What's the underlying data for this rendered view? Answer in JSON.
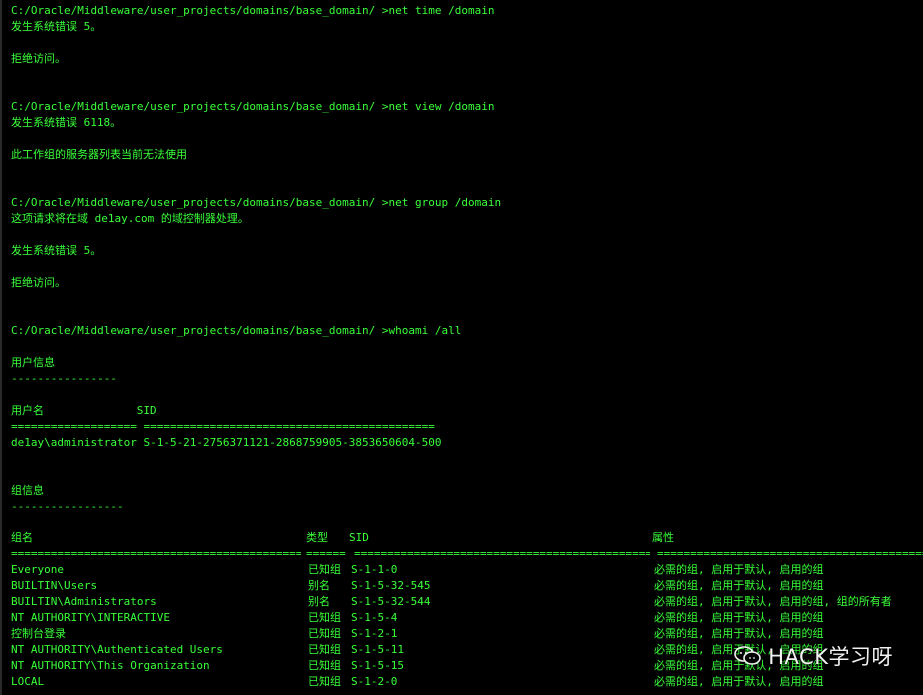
{
  "terminal": {
    "colors": {
      "background": "#000000",
      "text": "#39ff39",
      "watermark": "#f2f2f2"
    },
    "lines": [
      "C:/Oracle/Middleware/user_projects/domains/base_domain/ >net time /domain",
      "发生系统错误 5。",
      "",
      "拒绝访问。",
      "",
      "",
      "C:/Oracle/Middleware/user_projects/domains/base_domain/ >net view /domain",
      "发生系统错误 6118。",
      "",
      "此工作组的服务器列表当前无法使用",
      "",
      "",
      "C:/Oracle/Middleware/user_projects/domains/base_domain/ >net group /domain",
      "这项请求将在域 de1ay.com 的域控制器处理。",
      "",
      "发生系统错误 5。",
      "",
      "拒绝访问。",
      "",
      "",
      "C:/Oracle/Middleware/user_projects/domains/base_domain/ >whoami /all",
      "",
      "用户信息",
      "----------------",
      "",
      "用户名              SID",
      "=================== ============================================",
      "de1ay\\administrator S-1-5-21-2756371121-2868759905-3853650604-500",
      "",
      "",
      "组信息",
      "-----------------",
      ""
    ],
    "group_table": {
      "headers": {
        "name": "组名",
        "type": "类型",
        "sid": "SID",
        "attributes": "属性"
      },
      "rules": {
        "name": "============================================",
        "type": "======",
        "sid": "=============================================",
        "attributes": "============================================"
      },
      "rows": [
        {
          "name": "Everyone",
          "type": "已知组",
          "sid": "S-1-1-0",
          "attributes": "必需的组, 启用于默认, 启用的组"
        },
        {
          "name": "BUILTIN\\Users",
          "type": "别名",
          "sid": "S-1-5-32-545",
          "attributes": "必需的组, 启用于默认, 启用的组"
        },
        {
          "name": "BUILTIN\\Administrators",
          "type": "别名",
          "sid": "S-1-5-32-544",
          "attributes": "必需的组, 启用于默认, 启用的组, 组的所有者"
        },
        {
          "name": "NT AUTHORITY\\INTERACTIVE",
          "type": "已知组",
          "sid": "S-1-5-4",
          "attributes": "必需的组, 启用于默认, 启用的组"
        },
        {
          "name": "控制台登录",
          "type": "已知组",
          "sid": "S-1-2-1",
          "attributes": "必需的组, 启用于默认, 启用的组"
        },
        {
          "name": "NT AUTHORITY\\Authenticated Users",
          "type": "已知组",
          "sid": "S-1-5-11",
          "attributes": "必需的组, 启用于默认, 启用的组"
        },
        {
          "name": "NT AUTHORITY\\This Organization",
          "type": "已知组",
          "sid": "S-1-5-15",
          "attributes": "必需的组, 启用于默认, 启用的组"
        },
        {
          "name": "LOCAL",
          "type": "已知组",
          "sid": "S-1-2-0",
          "attributes": "必需的组, 启用于默认, 启用的组"
        }
      ]
    }
  },
  "watermark": {
    "icon": "wechat-icon",
    "text": "HACK学习呀"
  }
}
